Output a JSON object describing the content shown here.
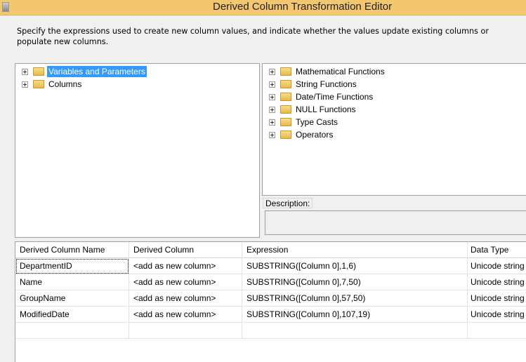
{
  "window": {
    "title": "Derived Column Transformation Editor"
  },
  "instructions": "Specify the expressions used to create new column values, and indicate whether the values update existing columns or populate new columns.",
  "left_tree": [
    {
      "label": "Variables and Parameters",
      "selected": true
    },
    {
      "label": "Columns"
    }
  ],
  "right_tree": [
    {
      "label": "Mathematical Functions"
    },
    {
      "label": "String Functions"
    },
    {
      "label": "Date/Time Functions"
    },
    {
      "label": "NULL Functions"
    },
    {
      "label": "Type Casts"
    },
    {
      "label": "Operators"
    }
  ],
  "description": {
    "label": "Description:",
    "value": ""
  },
  "grid": {
    "headers": [
      "Derived Column Name",
      "Derived Column",
      "Expression",
      "Data Type"
    ],
    "rows": [
      [
        "DepartmentID",
        "<add as new column>",
        "SUBSTRING([Column 0],1,6)",
        "Unicode string"
      ],
      [
        "Name",
        "<add as new column>",
        "SUBSTRING([Column 0],7,50)",
        "Unicode string"
      ],
      [
        "GroupName",
        "<add as new column>",
        "SUBSTRING([Column 0],57,50)",
        "Unicode string"
      ],
      [
        "ModifiedDate",
        "<add as new column>",
        "SUBSTRING([Column 0],107,19)",
        "Unicode string"
      ]
    ]
  },
  "colors": {
    "titlebar": "#f2c76f",
    "selection": "#3399ff"
  }
}
